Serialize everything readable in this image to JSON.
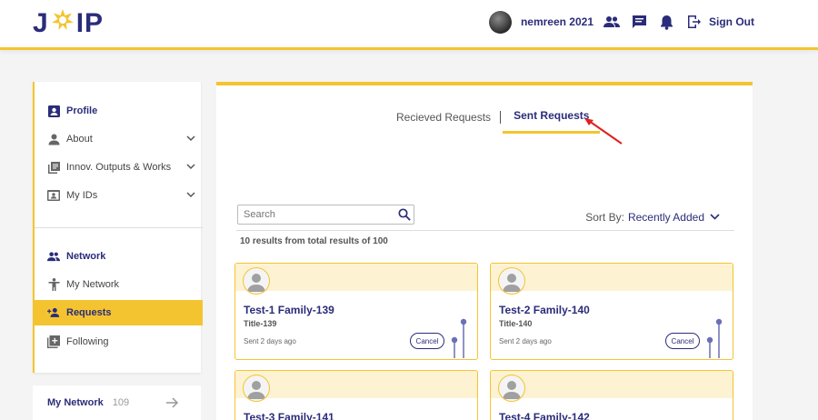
{
  "header": {
    "logo_left": "J",
    "logo_right": "IP",
    "username": "nemreen 2021",
    "signout_label": "Sign Out",
    "icons": [
      "avatar",
      "people-icon",
      "chat-icon",
      "bell-icon",
      "signout-icon"
    ]
  },
  "sidebar": {
    "items": [
      {
        "label": "Profile",
        "icon": "profile-icon"
      },
      {
        "label": "About",
        "icon": "person-icon"
      },
      {
        "label": "Innov. Outputs & Works",
        "icon": "library-icon"
      },
      {
        "label": "My IDs",
        "icon": "id-card-icon"
      },
      {
        "label": "Network",
        "icon": "people-icon"
      },
      {
        "label": "My Network",
        "icon": "accessibility-icon"
      },
      {
        "label": "Requests",
        "icon": "person-add-icon"
      },
      {
        "label": "Following",
        "icon": "add-box-icon"
      }
    ],
    "bottom": {
      "label": "My Network",
      "count": "109"
    }
  },
  "main": {
    "tabs": [
      {
        "label": "Recieved Requests",
        "active": false
      },
      {
        "label": "Sent Requests",
        "active": true
      }
    ],
    "search_placeholder": "Search",
    "sort_label": "Sort By:",
    "sort_value": "Recently Added",
    "results_text": "10 results from total results of 100",
    "cards": [
      {
        "name": "Test-1 Family-139",
        "title": "Title-139",
        "sent": "Sent 2 days ago",
        "cancel": "Cancel"
      },
      {
        "name": "Test-2 Family-140",
        "title": "Title-140",
        "sent": "Sent 2 days ago",
        "cancel": "Cancel"
      },
      {
        "name": "Test-3 Family-141",
        "title": "",
        "sent": "",
        "cancel": ""
      },
      {
        "name": "Test-4 Family-142",
        "title": "",
        "sent": "",
        "cancel": ""
      }
    ]
  },
  "colors": {
    "brand_navy": "#2b2c7a",
    "accent_yellow": "#f4c430",
    "card_header": "#fdf3d3",
    "annotation_red": "#e02020"
  }
}
